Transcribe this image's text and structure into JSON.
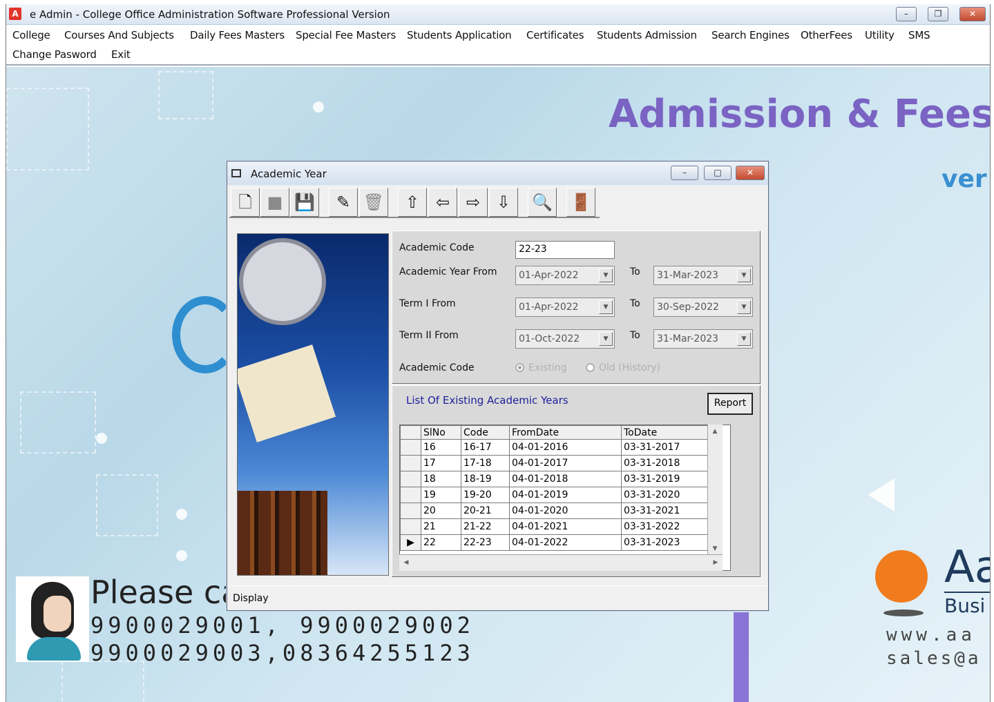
{
  "app": {
    "icon_letter": "A",
    "title": "e Admin - College Office Administration Software Professional Version",
    "controls": {
      "minimize": "–",
      "restore": "❐",
      "close": "✕"
    }
  },
  "menu": [
    "College",
    "Courses And Subjects",
    "Daily Fees Masters",
    "Special Fee Masters",
    "Students Application",
    "Certificates",
    "Students Admission",
    "Search Engines",
    "OtherFees",
    "Utility",
    "SMS",
    "Change Pasword",
    "Exit"
  ],
  "background": {
    "banner_title": "Admission & Fees M",
    "banner_version": "ver",
    "please_call": "Please  ca",
    "phone_line_1": "9900029001, 9900029002",
    "phone_line_2": "9900029003,08364255123",
    "logo_aa": "Aa",
    "logo_busi": "Busi",
    "logo_www": "www.aa",
    "logo_sales": "sales@a"
  },
  "dialog": {
    "title": "Academic Year",
    "controls": {
      "minimize": "–",
      "maximize": "□",
      "close": "✕"
    },
    "toolbar": [
      {
        "name": "new-icon",
        "glyph": "🗋",
        "disabled": false
      },
      {
        "name": "edit-icon",
        "glyph": "■",
        "disabled": true
      },
      {
        "name": "save-icon",
        "glyph": "💾",
        "disabled": true
      },
      {
        "name": "edit-form-icon",
        "glyph": "✎",
        "disabled": false
      },
      {
        "name": "delete-icon",
        "glyph": "🗑",
        "disabled": true
      },
      {
        "name": "first-record-icon",
        "glyph": "⇧",
        "disabled": false
      },
      {
        "name": "previous-record-icon",
        "glyph": "⇦",
        "disabled": false
      },
      {
        "name": "next-record-icon",
        "glyph": "⇨",
        "disabled": false
      },
      {
        "name": "last-record-icon",
        "glyph": "⇩",
        "disabled": false
      },
      {
        "name": "find-icon",
        "glyph": "🔍",
        "disabled": false
      },
      {
        "name": "exit-door-icon",
        "glyph": "🚪",
        "disabled": false
      }
    ],
    "form": {
      "academic_code_label": "Academic Code",
      "academic_code_value": "22-23",
      "year_from_label": "Academic Year From",
      "year_from_value": "01-Apr-2022",
      "to_label": "To",
      "year_to_value": "31-Mar-2023",
      "term1_label": "Term I From",
      "term1_from_value": "01-Apr-2022",
      "term1_to_value": "30-Sep-2022",
      "term2_label": "Term II From",
      "term2_from_value": "01-Oct-2022",
      "term2_to_value": "31-Mar-2023",
      "academic_code_type_label": "Academic Code",
      "radio_existing": "Existing",
      "radio_old": "Old (History)",
      "radio_selected": "existing"
    },
    "list": {
      "title": "List Of Existing  Academic Years",
      "report_label": "Report",
      "columns": [
        "SlNo",
        "Code",
        "FromDate",
        "ToDate"
      ],
      "rows": [
        [
          "16",
          "16-17",
          "04-01-2016",
          "03-31-2017"
        ],
        [
          "17",
          "17-18",
          "04-01-2017",
          "03-31-2018"
        ],
        [
          "18",
          "18-19",
          "04-01-2018",
          "03-31-2019"
        ],
        [
          "19",
          "19-20",
          "04-01-2019",
          "03-31-2020"
        ],
        [
          "20",
          "20-21",
          "04-01-2020",
          "03-31-2021"
        ],
        [
          "21",
          "21-22",
          "04-01-2021",
          "03-31-2022"
        ],
        [
          "22",
          "22-23",
          "04-01-2022",
          "03-31-2023"
        ]
      ],
      "current_row_index": 6,
      "current_row_marker": "▶"
    },
    "status": "Display"
  }
}
